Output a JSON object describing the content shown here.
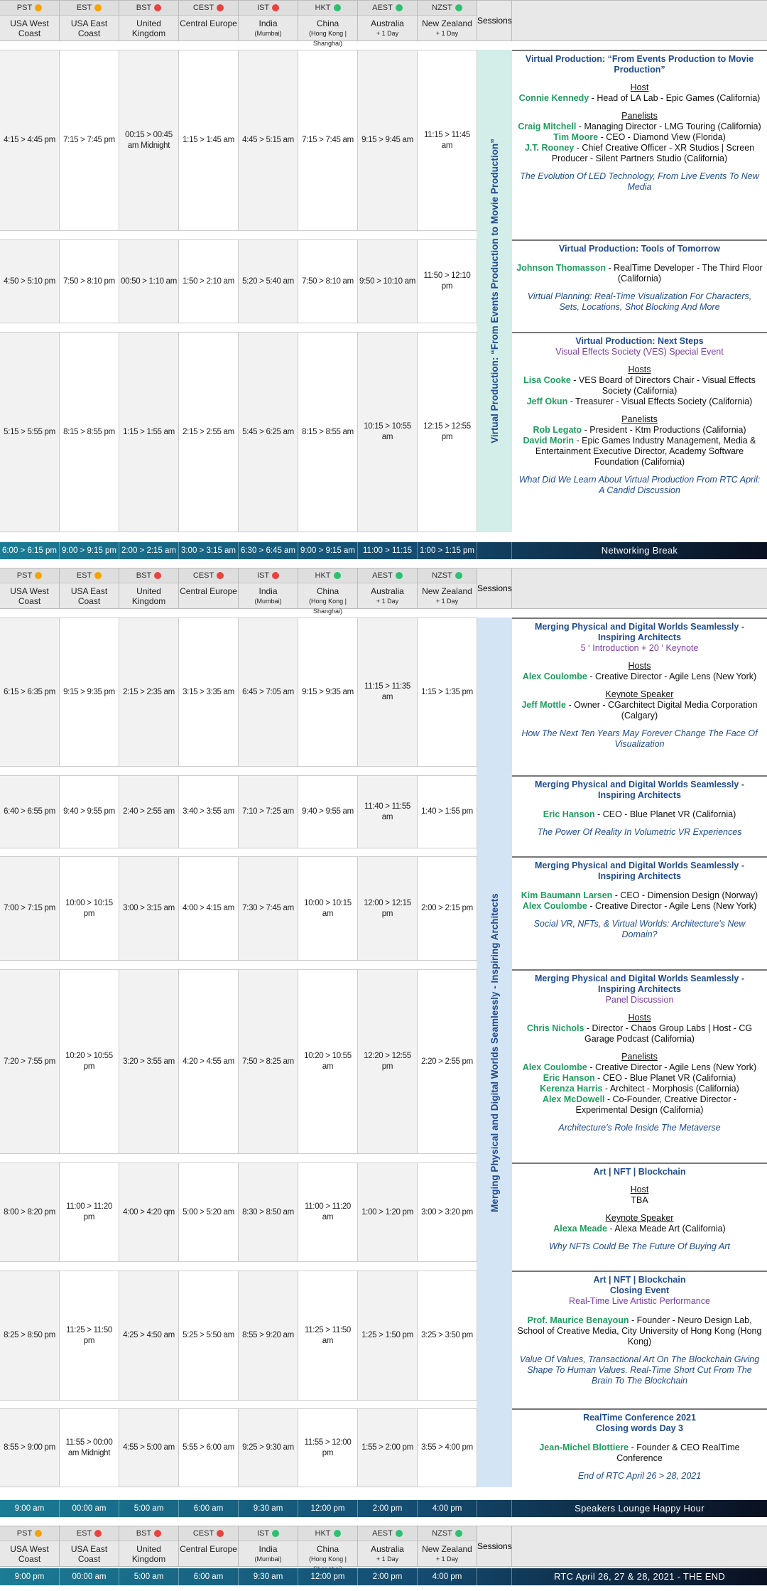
{
  "timezones": [
    {
      "abbr": "PST",
      "dot": "#f5a300",
      "name": "USA West Coast",
      "sub": ""
    },
    {
      "abbr": "EST",
      "dot": "#f5a300",
      "name": "USA East Coast",
      "sub": ""
    },
    {
      "abbr": "BST",
      "dot": "#e8433f",
      "name": "United Kingdom",
      "sub": ""
    },
    {
      "abbr": "CEST",
      "dot": "#e8433f",
      "name": "Central Europe",
      "sub": ""
    },
    {
      "abbr": "IST",
      "dot": "#e8433f",
      "name": "India",
      "sub": "(Mumbai)"
    },
    {
      "abbr": "HKT",
      "dot": "#2fbf71",
      "name": "China",
      "sub": "(Hong Kong | Shanghai)"
    },
    {
      "abbr": "AEST",
      "dot": "#2fbf71",
      "name": "Australia",
      "sub": "+ 1 Day"
    },
    {
      "abbr": "NZST",
      "dot": "#2fbf71",
      "name": "New Zealand",
      "sub": "+ 1 Day"
    }
  ],
  "sessions_label": "Sessions",
  "band1": "Virtual Production: “From Events Production to Movie Production”",
  "band2": "Merging Physical and Digital Worlds Seamlessly - Inspiring Architects",
  "block1": [
    {
      "times": [
        "4:15 > 4:45 pm",
        "7:15 > 7:45 pm",
        "00:15 > 00:45 am Midnight",
        "1:15 > 1:45 am",
        "4:45 > 5:15 am",
        "7:15 > 7:45 am",
        "9:15 > 9:45 am",
        "11:15 > 11:45 am"
      ],
      "title": "Virtual Production: “From Events Production to Movie Production”",
      "sub": "",
      "groups": [
        {
          "head": "Host",
          "people": [
            {
              "name": "Connie Kennedy",
              "role": " - Head of LA Lab - Epic Games (California)"
            }
          ]
        },
        {
          "head": "Panelists",
          "people": [
            {
              "name": "Craig Mitchell",
              "role": " - Managing Director - LMG Touring (California)"
            },
            {
              "name": "Tim Moore",
              "role": " - CEO - Diamond View (Florida)"
            },
            {
              "name": "J.T. Rooney",
              "role": " - Chief Creative Officer - XR Studios | Screen Producer -  Silent Partners Studio (California)"
            }
          ]
        }
      ],
      "talk": "The Evolution Of LED Technology, From Live Events To New Media"
    },
    {
      "times": [
        "4:50 > 5:10 pm",
        "7:50 > 8:10 pm",
        "00:50 > 1:10 am",
        "1:50 > 2:10 am",
        "5:20 > 5:40 am",
        "7:50 > 8:10 am",
        "9:50 > 10:10 am",
        "11:50 > 12:10 pm"
      ],
      "title": "Virtual Production: Tools of Tomorrow",
      "sub": "",
      "groups": [
        {
          "head": "",
          "people": [
            {
              "name": "Johnson Thomasson",
              "role": " - RealTime Developer - The Third Floor (California)"
            }
          ]
        }
      ],
      "talk": "Virtual Planning: Real-Time Visualization For Characters, Sets, Locations, Shot Blocking And More"
    },
    {
      "times": [
        "5:15 > 5:55 pm",
        "8:15 > 8:55 pm",
        "1:15 > 1:55 am",
        "2:15 > 2:55 am",
        "5:45 > 6:25 am",
        "8:15 > 8:55 am",
        "10:15 > 10:55 am",
        "12:15 > 12:55 pm"
      ],
      "title": "Virtual Production: Next Steps",
      "sub": "Visual Effects Society (VES) Special Event",
      "groups": [
        {
          "head": "Hosts",
          "people": [
            {
              "name": "Lisa Cooke",
              "role": " - VES Board of Directors Chair - Visual Effects Society (California)"
            },
            {
              "name": "Jeff Okun",
              "role": " - Treasurer - Visual Effects Society (California)"
            }
          ]
        },
        {
          "head": "Panelists",
          "people": [
            {
              "name": "Rob Legato",
              "role": " - President - Ktm Productions (California)"
            },
            {
              "name": "David Morin",
              "role": " - Epic Games Industry Management, Media & Entertainment Executive Director, Academy Software Foundation (California)"
            }
          ]
        }
      ],
      "talk": "What Did We Learn About Virtual Production From RTC April: A Candid Discussion"
    }
  ],
  "break1": {
    "times": [
      "6:00 > 6:15 pm",
      "9:00 > 9:15 pm",
      "2:00 > 2:15 am",
      "3:00 > 3:15 am",
      "6:30 > 6:45 am",
      "9:00 > 9:15 am",
      "11:00 > 11:15 am",
      "1:00 > 1:15 pm"
    ],
    "label": "Networking Break"
  },
  "block2": [
    {
      "times": [
        "6:15 > 6:35 pm",
        "9:15 > 9:35 pm",
        "2:15 > 2:35 am",
        "3:15 > 3:35 am",
        "6:45 > 7:05 am",
        "9:15 > 9:35 am",
        "11:15 > 11:35 am",
        "1:15 > 1:35 pm"
      ],
      "title": "Merging Physical and Digital Worlds Seamlessly - Inspiring Architects",
      "sub": "5 ‘ Introduction + 20 ‘ Keynote",
      "groups": [
        {
          "head": "Hosts",
          "people": [
            {
              "name": "Alex Coulombe",
              "role": " - Creative Director - Agile Lens (New York)"
            }
          ]
        },
        {
          "head": "Keynote Speaker",
          "people": [
            {
              "name": "Jeff Mottle",
              "role": " - Owner - CGarchitect Digital Media Corporation (Calgary)"
            }
          ]
        }
      ],
      "talk": "How The Next Ten Years May Forever Change The Face Of Visualization"
    },
    {
      "times": [
        "6:40 > 6:55 pm",
        "9:40 > 9:55 pm",
        "2:40 > 2:55 am",
        "3:40 > 3:55 am",
        "7:10 > 7:25 am",
        "9:40 > 9:55 am",
        "11:40 > 11:55 am",
        "1:40 > 1:55 pm"
      ],
      "title": "Merging Physical and Digital Worlds Seamlessly - Inspiring Architects",
      "sub": "",
      "groups": [
        {
          "head": "",
          "people": [
            {
              "name": "Eric Hanson",
              "role": " - CEO - Blue Planet VR (California)"
            }
          ]
        }
      ],
      "talk": "The Power Of Reality In Volumetric VR Experiences"
    },
    {
      "times": [
        "7:00 > 7:15 pm",
        "10:00 > 10:15 pm",
        "3:00 > 3:15 am",
        "4:00 > 4:15 am",
        "7:30 > 7:45 am",
        "10:00 > 10:15 am",
        "12:00 > 12:15 pm",
        "2:00 > 2:15 pm"
      ],
      "title": "Merging Physical and Digital Worlds Seamlessly - Inspiring Architects",
      "sub": "",
      "groups": [
        {
          "head": "",
          "people": [
            {
              "name": "Kim Baumann Larsen",
              "role": " - CEO - Dimension Design (Norway)"
            },
            {
              "name": "Alex Coulombe",
              "role": " - Creative Director - Agile Lens (New York)"
            }
          ]
        }
      ],
      "talk": "Social VR, NFTs, & Virtual Worlds: Architecture's New Domain?"
    },
    {
      "times": [
        "7:20 > 7:55 pm",
        "10:20 > 10:55 pm",
        "3:20 > 3:55 am",
        "4:20 > 4:55 am",
        "7:50 > 8:25 am",
        "10:20 > 10:55 am",
        "12:20 > 12:55 pm",
        "2:20 > 2:55 pm"
      ],
      "title": "Merging Physical and Digital Worlds Seamlessly - Inspiring Architects",
      "sub": "Panel Discussion",
      "groups": [
        {
          "head": "Hosts",
          "people": [
            {
              "name": "Chris Nichols",
              "role": " - Director - Chaos Group Labs | Host - CG Garage Podcast (California)"
            }
          ]
        },
        {
          "head": "Panelists",
          "people": [
            {
              "name": "Alex Coulombe",
              "role": " - Creative Director - Agile Lens (New York)"
            },
            {
              "name": "Eric Hanson",
              "role": " - CEO - Blue Planet VR (California)"
            },
            {
              "name": "Kerenza Harris",
              "role": " - Architect - Morphosis (California)"
            },
            {
              "name": "Alex McDowell",
              "role": " - Co-Founder, Creative Director - Experimental Design (California)"
            }
          ]
        }
      ],
      "talk": "Architecture's Role Inside The Metaverse"
    },
    {
      "times": [
        "8:00 > 8:20 pm",
        "11:00 > 11:20 pm",
        "4:00 > 4:20 qm",
        "5:00 > 5:20 am",
        "8:30 > 8:50 am",
        "11:00 > 11:20 am",
        "1:00 > 1:20 pm",
        "3:00 > 3:20 pm"
      ],
      "title": "Art | NFT | Blockchain",
      "sub": "",
      "groups": [
        {
          "head": "Host",
          "people": [
            {
              "name": "",
              "role": "TBA"
            }
          ]
        },
        {
          "head": "Keynote Speaker",
          "people": [
            {
              "name": "Alexa Meade",
              "role": " - Alexa Meade Art (California)"
            }
          ]
        }
      ],
      "talk": "Why NFTs Could Be The Future Of Buying Art"
    },
    {
      "times": [
        "8:25 > 8:50 pm",
        "11:25 > 11:50 pm",
        "4:25 > 4:50 am",
        "5:25 > 5:50 am",
        "8:55 > 9:20 am",
        "11:25 > 11:50 am",
        "1:25 > 1:50 pm",
        "3:25 > 3:50 pm"
      ],
      "title": "Art | NFT | Blockchain\nClosing Event",
      "sub": "Real-Time Live Artistic Performance",
      "groups": [
        {
          "head": "",
          "people": [
            {
              "name": "Prof. Maurice Benayoun",
              "role": " - Founder - Neuro Design Lab, School of Creative Media, City University of Hong Kong (Hong Kong)"
            }
          ]
        }
      ],
      "talk": "Value Of Values, Transactional Art On The Blockchain Giving Shape To Human Values. Real-Time Short Cut From The Brain To The Blockchain"
    },
    {
      "times": [
        "8:55 > 9:00 pm",
        "11:55 > 00:00 am Midnight",
        "4:55 > 5:00 am",
        "5:55 > 6:00 am",
        "9:25 > 9:30 am",
        "11:55 > 12:00 pm",
        "1:55 > 2:00 pm",
        "3:55 > 4:00 pm"
      ],
      "title": "RealTime Conference 2021\nClosing words Day 3",
      "sub": "",
      "groups": [
        {
          "head": "",
          "people": [
            {
              "name": "Jean-Michel Blottiere",
              "role": " - Founder & CEO RealTime Conference"
            }
          ]
        }
      ],
      "talk": "End of RTC April 26 > 28, 2021"
    }
  ],
  "break2": {
    "times": [
      "9:00 am",
      "00:00 am",
      "5:00 am",
      "6:00 am",
      "9:30 am",
      "12:00 pm",
      "2:00 pm",
      "4:00 pm"
    ],
    "label": "Speakers Lounge Happy Hour"
  },
  "footer": {
    "times": [
      "9:00 pm",
      "00:00 am",
      "5:00 am",
      "6:00 am",
      "9:30 am",
      "12:00 pm",
      "2:00 pm",
      "4:00 pm"
    ],
    "label": "RTC April 26, 27 & 28, 2021 - THE END"
  },
  "header3_dots": [
    "#f5a300",
    "#e8433f",
    "#e8433f",
    "#e8433f",
    "#2fbf71",
    "#2fbf71",
    "#2fbf71",
    "#2fbf71"
  ]
}
